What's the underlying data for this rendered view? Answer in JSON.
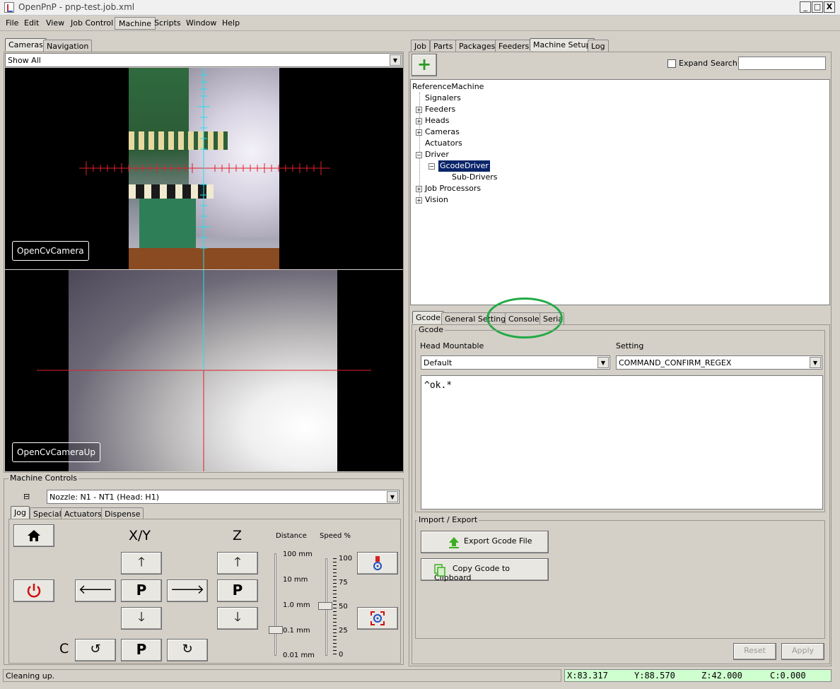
{
  "window": {
    "title": "OpenPnP - pnp-test.job.xml",
    "controls": [
      "_",
      "□",
      "X"
    ]
  },
  "menu": [
    "File",
    "Edit",
    "View",
    "Job Control",
    "Machine",
    "Scripts",
    "Window",
    "Help"
  ],
  "left": {
    "tabs": [
      "Cameras",
      "Navigation"
    ],
    "camera_filter": "Show All",
    "camera_top_label": "OpenCvCamera",
    "camera_bottom_label": "OpenCvCameraUp"
  },
  "machine_controls": {
    "title": "Machine Controls",
    "collapse_symbol": "⊟",
    "nozzle": "Nozzle: N1 - NT1 (Head: H1)",
    "tabs": [
      "Jog",
      "Special",
      "Actuators",
      "Dispense"
    ],
    "xy_label": "X/Y",
    "z_label": "Z",
    "c_label": "C",
    "park_label": "P",
    "distance_label": "Distance",
    "speed_label": "Speed %",
    "distance_ticks": [
      "100 mm",
      "10 mm",
      "1.0 mm",
      "0.1 mm",
      "0.01 mm"
    ],
    "speed_ticks": [
      "100",
      "75",
      "50",
      "25",
      "0"
    ],
    "distance_value": "0.1 mm",
    "speed_value_percent": 50
  },
  "right": {
    "tabs": [
      "Job",
      "Parts",
      "Packages",
      "Feeders",
      "Machine Setup",
      "Log"
    ],
    "add_button": "+",
    "expand_label": "Expand",
    "search_label": "Search",
    "search_value": "",
    "tree": [
      {
        "label": "ReferenceMachine",
        "level": 0,
        "toggle": ""
      },
      {
        "label": "Signalers",
        "level": 1,
        "toggle": ""
      },
      {
        "label": "Feeders",
        "level": 1,
        "toggle": "+"
      },
      {
        "label": "Heads",
        "level": 1,
        "toggle": "+"
      },
      {
        "label": "Cameras",
        "level": 1,
        "toggle": "+"
      },
      {
        "label": "Actuators",
        "level": 1,
        "toggle": ""
      },
      {
        "label": "Driver",
        "level": 1,
        "toggle": "-"
      },
      {
        "label": "GcodeDriver",
        "level": 2,
        "toggle": "-",
        "selected": true
      },
      {
        "label": "Sub-Drivers",
        "level": 3,
        "toggle": ""
      },
      {
        "label": "Job Processors",
        "level": 1,
        "toggle": "+"
      },
      {
        "label": "Vision",
        "level": 1,
        "toggle": "+"
      }
    ],
    "detail_tabs": [
      "Gcode",
      "General Settings",
      "Console",
      "Serial"
    ],
    "gcode_group": "Gcode",
    "head_mountable_label": "Head Mountable",
    "head_mountable_value": "Default",
    "setting_label": "Setting",
    "setting_value": "COMMAND_CONFIRM_REGEX",
    "gcode_text": "^ok.*",
    "import_export_group": "Import / Export",
    "export_button": "Export Gcode File",
    "copy_button": "Copy Gcode to Clipboard",
    "reset_button": "Reset",
    "apply_button": "Apply"
  },
  "status": {
    "message": "Cleaning up."
  },
  "dro": {
    "x": "X:83.317",
    "y": "Y:88.570",
    "z": "Z:42.000",
    "c": "C:0.000"
  },
  "colors": {
    "highlight_circle": "#22aa44",
    "tree_selected": "#0a246a",
    "dro_bg": "#cfffcf",
    "crosshair": "#e0202a",
    "crosshair_cyan": "#20e0f0"
  }
}
